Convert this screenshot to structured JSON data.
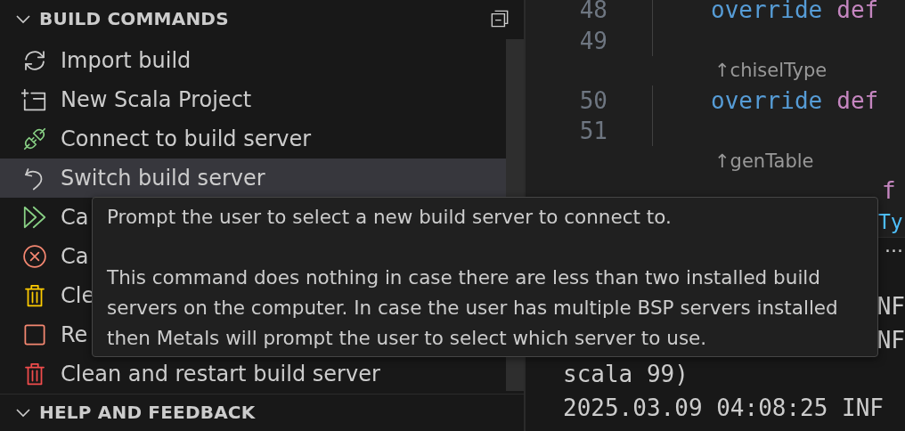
{
  "sidebar": {
    "sections": [
      {
        "title": "BUILD COMMANDS",
        "expanded": true,
        "items": [
          {
            "kind": "sync",
            "label": "Import build",
            "selected": false
          },
          {
            "kind": "new-project",
            "label": "New Scala Project",
            "selected": false
          },
          {
            "kind": "plug",
            "label": "Connect to build server",
            "selected": false
          },
          {
            "kind": "switch",
            "label": "Switch build server",
            "selected": true
          },
          {
            "kind": "cascade",
            "label": "Ca",
            "selected": false
          },
          {
            "kind": "cancel",
            "label": "Ca",
            "selected": false
          },
          {
            "kind": "clean",
            "label": "Cle",
            "selected": false
          },
          {
            "kind": "restart",
            "label": "Re",
            "selected": false
          },
          {
            "kind": "clean-restart",
            "label": "Clean and restart build server",
            "selected": false
          }
        ]
      },
      {
        "title": "HELP AND FEEDBACK",
        "expanded": true
      }
    ]
  },
  "editor": {
    "lines": [
      {
        "kind": "code",
        "number": "48",
        "keyword": "override",
        "def": "def"
      },
      {
        "kind": "code",
        "number": "49"
      },
      {
        "kind": "lens",
        "text": "↑chiselType"
      },
      {
        "kind": "code",
        "number": "50",
        "keyword": "override",
        "def": "def"
      },
      {
        "kind": "code",
        "number": "51"
      },
      {
        "kind": "lens",
        "text": "↑genTable"
      },
      {
        "kind": "partial",
        "def": "f"
      },
      {
        "kind": "type",
        "text": "Ty"
      }
    ]
  },
  "terminal": {
    "menu": "···",
    "lines": [
      {
        "kind": "tail",
        "text": "NF"
      },
      {
        "kind": "tail",
        "text": "NF"
      },
      {
        "kind": "line",
        "text": "scala 99)"
      },
      {
        "kind": "line",
        "text": "2025.03.09 04:08:25 INF"
      }
    ]
  },
  "tooltip": {
    "paragraphs": [
      "Prompt the user to select a new build server to connect to.",
      "This command does nothing in case there are less than two installed build servers on the computer. In case the user has multiple BSP servers installed then Metals will prompt the user to select which server to use."
    ]
  }
}
